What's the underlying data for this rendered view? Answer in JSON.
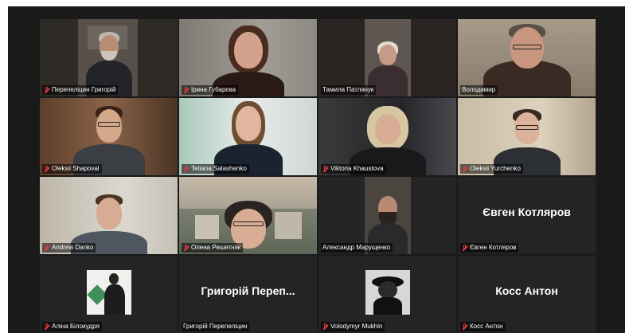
{
  "participants": [
    {
      "name": "Перепеліцин Григорій",
      "muted": true
    },
    {
      "name": "Ірина Губарєва",
      "muted": true
    },
    {
      "name": "Тамила Патлачук",
      "muted": false
    },
    {
      "name": "Володимир",
      "muted": false,
      "speaking": true
    },
    {
      "name": "Oleksii Shapoval",
      "muted": true
    },
    {
      "name": "Tetiana Salashenko",
      "muted": true
    },
    {
      "name": "Viktoria Khaustova",
      "muted": true
    },
    {
      "name": "Oleksii Yurchenko",
      "muted": true
    },
    {
      "name": "Andrew Danko",
      "muted": true
    },
    {
      "name": "Олена Решетняк",
      "muted": true
    },
    {
      "name": "Александр Марущенко",
      "muted": false
    },
    {
      "name": "Євген Котляров",
      "display_name": "Євген Котляров",
      "muted": true,
      "video_off": true
    },
    {
      "name": "Аліна Білокудря",
      "muted": true,
      "avatar": true
    },
    {
      "name": "Григорій Перепеліцин",
      "display_name": "Григорій Переп...",
      "muted": false,
      "video_off": true
    },
    {
      "name": "Volodymyr Mukhin",
      "muted": true,
      "avatar": true
    },
    {
      "name": "Косс Антон",
      "display_name": "Косс Антон",
      "muted": true,
      "video_off": true
    }
  ],
  "colors": {
    "background": "#1a1a1a",
    "tile": "#242424",
    "active_speaker_border": "#2fd06e",
    "muted_icon": "#e33b3b"
  },
  "icons": {
    "muted": "mic-muted-icon"
  }
}
